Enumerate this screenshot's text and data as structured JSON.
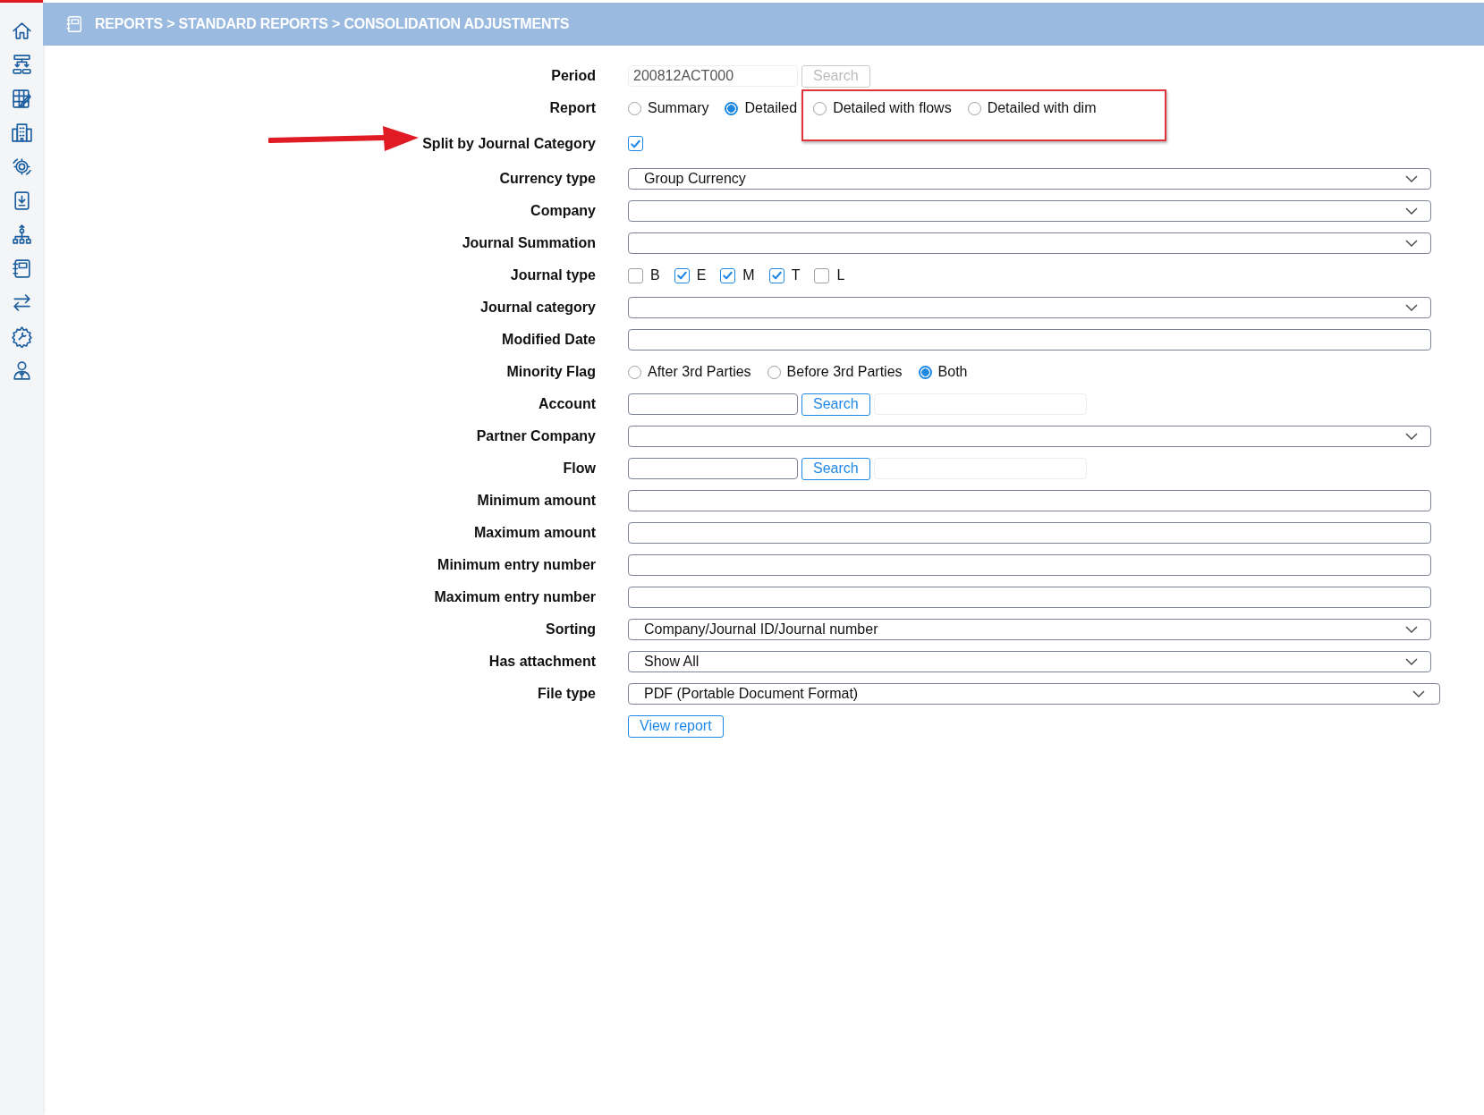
{
  "breadcrumb": "REPORTS > STANDARD REPORTS > CONSOLIDATION ADJUSTMENTS",
  "form": {
    "fields": [
      {
        "kind": "lookup",
        "label": "Period",
        "value": "200812ACT000",
        "button": "Search",
        "disabled": true
      },
      {
        "kind": "radio",
        "label": "Report",
        "options": [
          {
            "label": "Summary",
            "selected": false
          },
          {
            "label": "Detailed",
            "selected": true
          },
          {
            "label": "Detailed with flows",
            "selected": false
          },
          {
            "label": "Detailed with dim",
            "selected": false
          }
        ]
      },
      {
        "kind": "checkbox",
        "label": "Split by Journal Category",
        "checked": true
      },
      {
        "kind": "select",
        "label": "Currency type",
        "value": "Group Currency"
      },
      {
        "kind": "select",
        "label": "Company"
      },
      {
        "kind": "select",
        "label": "Journal Summation"
      },
      {
        "kind": "checks",
        "label": "Journal type",
        "options": [
          {
            "label": "B",
            "checked": false
          },
          {
            "label": "E",
            "checked": true
          },
          {
            "label": "M",
            "checked": true
          },
          {
            "label": "T",
            "checked": true
          },
          {
            "label": "L",
            "checked": false
          }
        ]
      },
      {
        "kind": "select",
        "label": "Journal category"
      },
      {
        "kind": "text",
        "label": "Modified Date"
      },
      {
        "kind": "radio",
        "label": "Minority Flag",
        "options": [
          {
            "label": "After 3rd Parties",
            "selected": false
          },
          {
            "label": "Before 3rd Parties",
            "selected": false
          },
          {
            "label": "Both",
            "selected": true
          }
        ]
      },
      {
        "kind": "lookup",
        "label": "Account",
        "button": "Search",
        "disabled": false
      },
      {
        "kind": "select",
        "label": "Partner Company"
      },
      {
        "kind": "lookup",
        "label": "Flow",
        "button": "Search",
        "disabled": false
      },
      {
        "kind": "text",
        "label": "Minimum amount"
      },
      {
        "kind": "text",
        "label": "Maximum amount"
      },
      {
        "kind": "text",
        "label": "Minimum entry number"
      },
      {
        "kind": "text",
        "label": "Maximum entry number"
      },
      {
        "kind": "select",
        "label": "Sorting",
        "value": "Company/Journal ID/Journal number"
      },
      {
        "kind": "select",
        "label": "Has attachment",
        "value": "Show All"
      },
      {
        "kind": "select",
        "label": "File type",
        "value": "PDF (Portable Document Format)",
        "wide": true
      }
    ],
    "submit": "View report"
  }
}
